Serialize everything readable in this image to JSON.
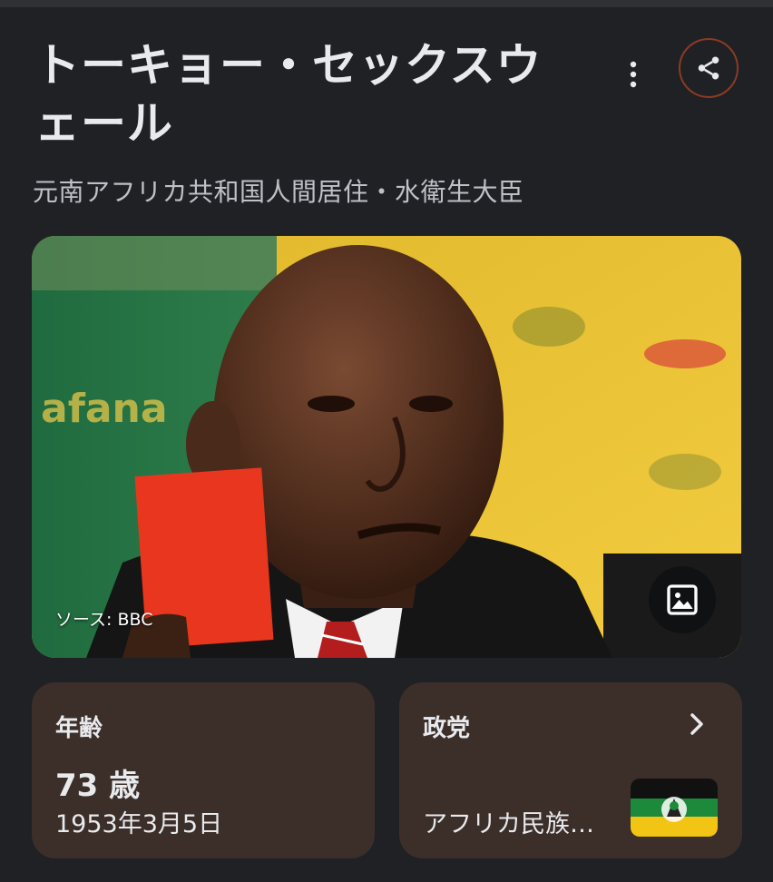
{
  "header": {
    "title": "トーキョー・セックスウェール",
    "subtitle": "元南アフリカ共和国人間居住・水衛生大臣",
    "more_icon": "more-vert-icon",
    "share_icon": "share-icon"
  },
  "photo": {
    "source_label": "ソース: BBC",
    "gallery_icon": "image-gallery-icon"
  },
  "cards": {
    "age": {
      "label": "年齢",
      "value": "73 歳",
      "birth_date": "1953年3月5日"
    },
    "party": {
      "label": "政党",
      "name": "アフリカ民族…",
      "chevron_icon": "chevron-right-icon"
    }
  },
  "colors": {
    "background": "#202124",
    "card": "#3c2f2a",
    "share_border": "#8c3a25",
    "red_card": "#e8361f"
  }
}
